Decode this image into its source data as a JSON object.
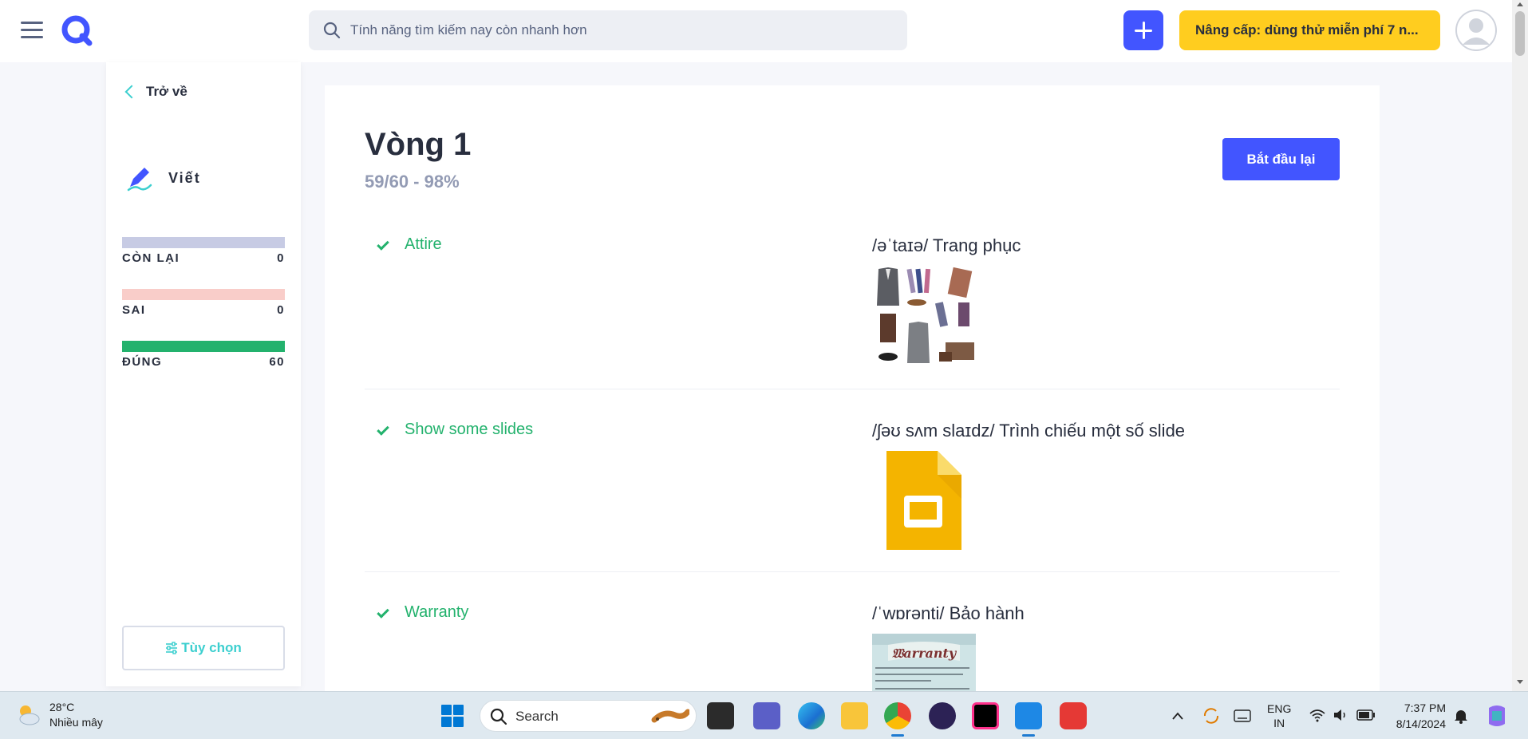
{
  "header": {
    "search_placeholder": "Tính năng tìm kiếm nay còn nhanh hơn",
    "upgrade_label": "Nâng cấp: dùng thử miễn phí 7 n..."
  },
  "sidebar": {
    "back_label": "Trở về",
    "mode_label": "Viết",
    "stats": [
      {
        "label": "CÒN LẠI",
        "value": "0",
        "color": "#c7cbe4"
      },
      {
        "label": "SAI",
        "value": "0",
        "color": "#f9cdc9"
      },
      {
        "label": "ĐÚNG",
        "value": "60",
        "color": "#23b26d"
      }
    ],
    "options_label": "Tùy chọn"
  },
  "main": {
    "round_title": "Vòng 1",
    "round_score": "59/60 - 98%",
    "restart_label": "Bắt đầu lại",
    "terms": [
      {
        "term": "Attire",
        "definition": "/əˈtaɪə/ Trang phục",
        "image": "clothing-collage"
      },
      {
        "term": "Show some slides",
        "definition": "/ʃəʊ sʌm slaɪdz/ Trình chiếu một số slide",
        "image": "google-slides-icon"
      },
      {
        "term": "Warranty",
        "definition": "/ˈwɒrənti/ Bảo hành",
        "image": "warranty-document"
      }
    ]
  },
  "taskbar": {
    "weather_temp": "28°C",
    "weather_desc": "Nhiều mây",
    "search_label": "Search",
    "lang_line1": "ENG",
    "lang_line2": "IN",
    "time": "7:37 PM",
    "date": "8/14/2024"
  },
  "colors": {
    "accent": "#4255ff",
    "correct": "#23b26d",
    "upgrade": "#ffcd1f",
    "teal": "#3ccfcf"
  }
}
